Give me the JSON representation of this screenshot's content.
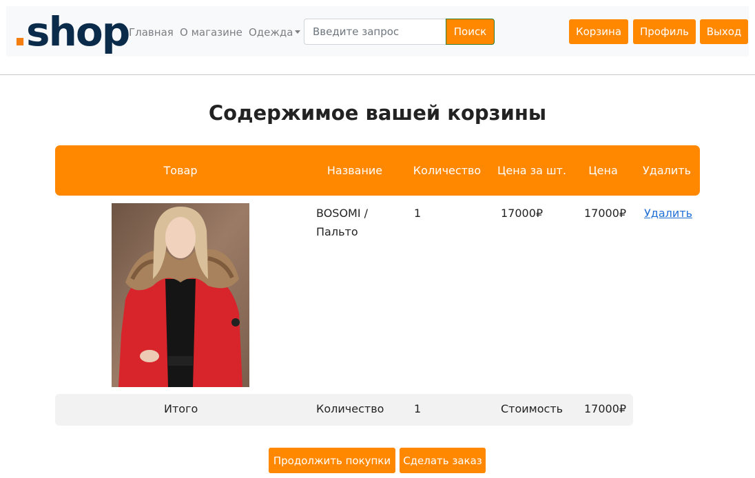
{
  "header": {
    "logo_dot": ".",
    "logo_text": "shop",
    "nav": {
      "home": "Главная",
      "about": "О магазине",
      "clothes": "Одежда"
    },
    "search": {
      "placeholder": "Введите запрос",
      "button": "Поиск"
    },
    "buttons": {
      "cart": "Корзина",
      "profile": "Профиль",
      "logout": "Выход"
    }
  },
  "page": {
    "title": "Содержимое вашей корзины"
  },
  "table": {
    "headers": {
      "item": "Товар",
      "name": "Название",
      "quantity": "Количество",
      "unit_price": "Цена за шт.",
      "price": "Цена",
      "delete": "Удалить"
    },
    "rows": [
      {
        "name": "BOSOMI / Пальто",
        "quantity": "1",
        "unit_price": "17000₽",
        "price": "17000₽",
        "delete": "Удалить"
      }
    ],
    "total": {
      "label": "Итого",
      "quantity_label": "Количество",
      "quantity": "1",
      "cost_label": "Стоимость",
      "cost": "17000₽"
    }
  },
  "actions": {
    "continue": "Продолжить покупки",
    "order": "Сделать заказ"
  },
  "colors": {
    "accent": "#ff8800",
    "logo": "#0b2b4a",
    "logo_dot": "#f47e0f",
    "link": "#1f6fd6"
  }
}
